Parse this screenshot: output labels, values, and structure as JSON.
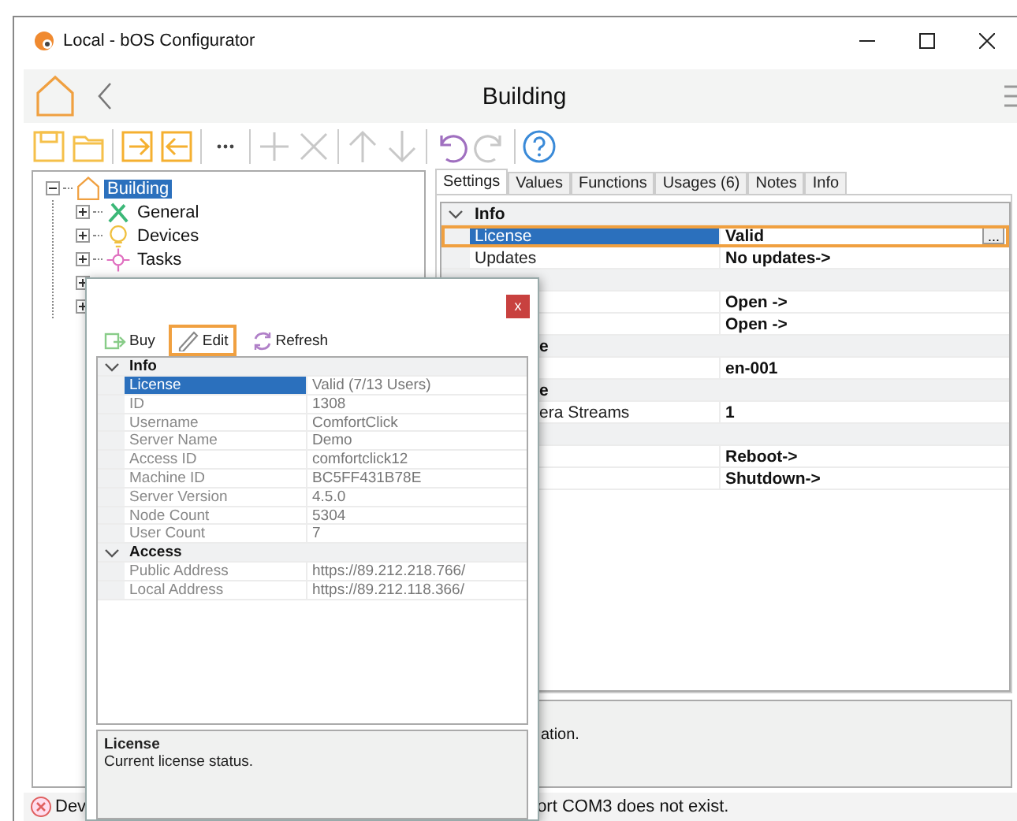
{
  "window": {
    "title": "Local - bOS Configurator"
  },
  "header": {
    "title": "Building"
  },
  "toolbar": [
    {
      "kind": "save",
      "disabled": false
    },
    {
      "kind": "open",
      "disabled": false
    },
    {
      "kind": "import",
      "disabled": false
    },
    {
      "kind": "export",
      "disabled": false
    },
    {
      "kind": "more",
      "disabled": false
    },
    {
      "kind": "add",
      "disabled": true
    },
    {
      "kind": "delete",
      "disabled": true
    },
    {
      "kind": "up",
      "disabled": true
    },
    {
      "kind": "down",
      "disabled": true
    },
    {
      "kind": "undo",
      "disabled": false
    },
    {
      "kind": "redo",
      "disabled": true
    },
    {
      "kind": "help",
      "disabled": false
    }
  ],
  "tree": [
    {
      "label": "Building",
      "kind": "building",
      "selected": true,
      "expanded": true,
      "children": [
        {
          "label": "General",
          "kind": "tools",
          "selected": false,
          "expanded": false
        },
        {
          "label": "Devices",
          "kind": "bulb",
          "selected": false,
          "expanded": false
        },
        {
          "label": "Tasks",
          "kind": "tasks",
          "selected": false,
          "expanded": false
        },
        {
          "expanded": false
        },
        {
          "expanded": false
        }
      ]
    }
  ],
  "tabs": [
    {
      "label": "Settings",
      "selected": true
    },
    {
      "label": "Values",
      "selected": false
    },
    {
      "label": "Functions",
      "selected": false
    },
    {
      "label": "Usages (6)",
      "selected": false
    },
    {
      "label": "Notes",
      "selected": false
    },
    {
      "label": "Info",
      "selected": false
    }
  ],
  "properties": {
    "rows": [
      {
        "kind": "category",
        "name": "Info",
        "expanded": true
      },
      {
        "kind": "property",
        "name": "License",
        "value": "Valid",
        "selected": true,
        "button": "..."
      },
      {
        "kind": "property",
        "name": "Updates",
        "value": "No updates->",
        "selected": false
      },
      {
        "kind": "category"
      },
      {
        "kind": "property",
        "value": "Open ->",
        "selected": false
      },
      {
        "kind": "property",
        "value": "Open ->",
        "selected": false
      },
      {
        "kind": "category",
        "name": "e"
      },
      {
        "kind": "property",
        "value": "en-001",
        "selected": false
      },
      {
        "kind": "category",
        "name": "e"
      },
      {
        "kind": "property",
        "name": "era Streams",
        "value": "1",
        "selected": false
      },
      {
        "kind": "category"
      },
      {
        "kind": "property",
        "value": "Reboot->",
        "selected": false
      },
      {
        "kind": "property",
        "value": "Shutdown->",
        "selected": false
      }
    ],
    "description": "ation."
  },
  "status": {
    "kind": "error",
    "texts": [
      "Dev",
      "ort COM3 does not exist."
    ]
  },
  "dialog": {
    "close": "x",
    "toolbar": [
      {
        "kind": "buy",
        "label": "Buy",
        "selected": false
      },
      {
        "kind": "edit",
        "label": "Edit",
        "selected": true
      },
      {
        "kind": "refresh",
        "label": "Refresh",
        "selected": false
      }
    ],
    "properties": {
      "rows": [
        {
          "kind": "category",
          "name": "Info",
          "expanded": true
        },
        {
          "kind": "property",
          "name": "License",
          "value": "Valid (7/13 Users)",
          "selected": true
        },
        {
          "kind": "property",
          "name": "ID",
          "value": "1308",
          "selected": false
        },
        {
          "kind": "property",
          "name": "Username",
          "value": "ComfortClick",
          "selected": false
        },
        {
          "kind": "property",
          "name": "Server Name",
          "value": "Demo",
          "selected": false
        },
        {
          "kind": "property",
          "name": "Access ID",
          "value": "comfortclick12",
          "selected": false
        },
        {
          "kind": "property",
          "name": "Machine ID",
          "value": "BC5FF431B78E",
          "selected": false
        },
        {
          "kind": "property",
          "name": "Server Version",
          "value": "4.5.0",
          "selected": false
        },
        {
          "kind": "property",
          "name": "Node Count",
          "value": "5304",
          "selected": false
        },
        {
          "kind": "property",
          "name": "User Count",
          "value": "7",
          "selected": false
        },
        {
          "kind": "category",
          "name": "Access",
          "expanded": true
        },
        {
          "kind": "property",
          "name": "Public Address",
          "value": "https://89.212.218.766/",
          "selected": false
        },
        {
          "kind": "property",
          "name": "Local Address",
          "value": "https://89.212.118.366/",
          "selected": false
        }
      ],
      "description": {
        "title": "License",
        "text": "Current license status."
      }
    }
  }
}
